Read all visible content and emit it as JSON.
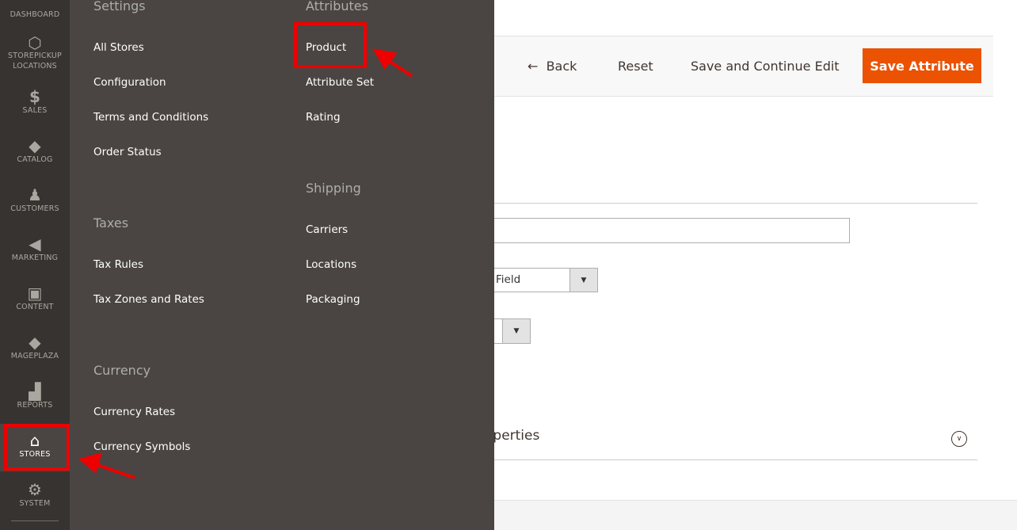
{
  "nav": {
    "items": [
      {
        "label": "DASHBOARD",
        "icon": "dashboard-icon"
      },
      {
        "label": "STOREPICKUP LOCATIONS",
        "icon": "hexagon-icon"
      },
      {
        "label": "SALES",
        "icon": "dollar-icon"
      },
      {
        "label": "CATALOG",
        "icon": "box-icon"
      },
      {
        "label": "CUSTOMERS",
        "icon": "person-icon"
      },
      {
        "label": "MARKETING",
        "icon": "megaphone-icon"
      },
      {
        "label": "CONTENT",
        "icon": "layout-icon"
      },
      {
        "label": "MAGEPLAZA",
        "icon": "box-icon"
      },
      {
        "label": "REPORTS",
        "icon": "bar-chart-icon"
      },
      {
        "label": "STORES",
        "icon": "storefront-icon",
        "active": true
      },
      {
        "label": "SYSTEM",
        "icon": "gear-icon"
      }
    ]
  },
  "flyout": {
    "settings": {
      "heading": "Settings",
      "items": [
        "All Stores",
        "Configuration",
        "Terms and Conditions",
        "Order Status"
      ]
    },
    "taxes": {
      "heading": "Taxes",
      "items": [
        "Tax Rules",
        "Tax Zones and Rates"
      ]
    },
    "currency": {
      "heading": "Currency",
      "items": [
        "Currency Rates",
        "Currency Symbols"
      ]
    },
    "attributes": {
      "heading": "Attributes",
      "items": [
        "Product",
        "Attribute Set",
        "Rating"
      ]
    },
    "shipping": {
      "heading": "Shipping",
      "items": [
        "Carriers",
        "Locations",
        "Packaging"
      ]
    }
  },
  "header": {
    "back": "Back",
    "reset": "Reset",
    "save_continue": "Save and Continue Edit",
    "save": "Save Attribute"
  },
  "form": {
    "input_type_value": "Field",
    "section_title": "operties"
  },
  "colors": {
    "accent": "#eb5202",
    "highlight": "#ee0000",
    "nav_bg": "#373330",
    "flyout_bg": "#4a4542"
  }
}
